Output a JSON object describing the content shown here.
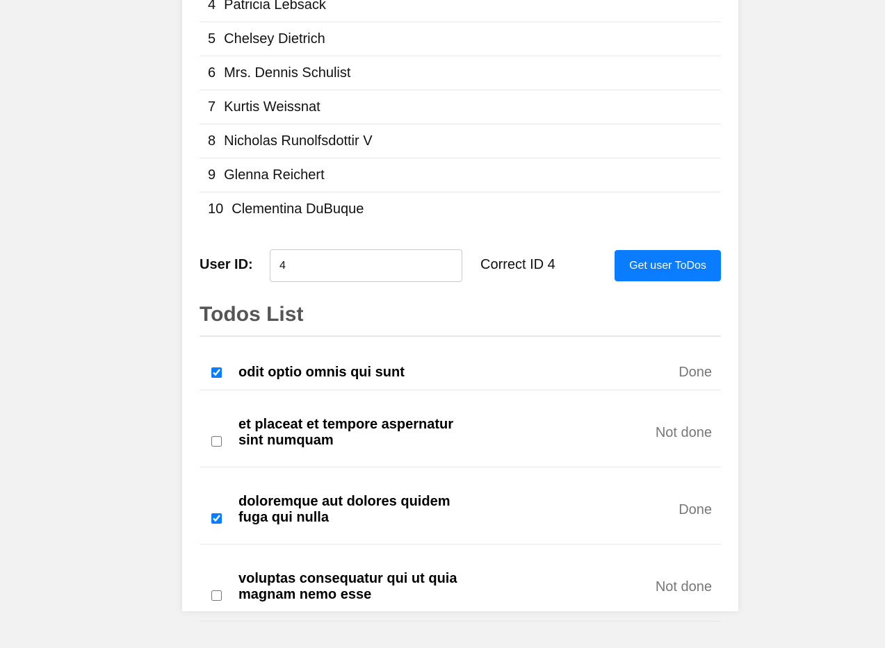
{
  "users": [
    {
      "id": "4",
      "name": "Patricia Lebsack"
    },
    {
      "id": "5",
      "name": "Chelsey Dietrich"
    },
    {
      "id": "6",
      "name": "Mrs. Dennis Schulist"
    },
    {
      "id": "7",
      "name": "Kurtis Weissnat"
    },
    {
      "id": "8",
      "name": "Nicholas Runolfsdottir V"
    },
    {
      "id": "9",
      "name": "Glenna Reichert"
    },
    {
      "id": "10",
      "name": "Clementina DuBuque"
    }
  ],
  "form": {
    "label": "User ID:",
    "value": "4",
    "correct_text": "Correct ID 4",
    "button_label": "Get user ToDos"
  },
  "todos_title": "Todos List",
  "todos": [
    {
      "title": "odit optio omnis qui sunt",
      "done": true,
      "status": "Done"
    },
    {
      "title": "et placeat et tempore aspernatur sint numquam",
      "done": false,
      "status": "Not done"
    },
    {
      "title": "doloremque aut dolores quidem fuga qui nulla",
      "done": true,
      "status": "Done"
    },
    {
      "title": "voluptas consequatur qui ut quia magnam nemo esse",
      "done": false,
      "status": "Not done"
    }
  ],
  "colors": {
    "accent": "#0a7cff",
    "background": "#f2f2f2",
    "card": "#ffffff",
    "status_text": "#777777"
  }
}
